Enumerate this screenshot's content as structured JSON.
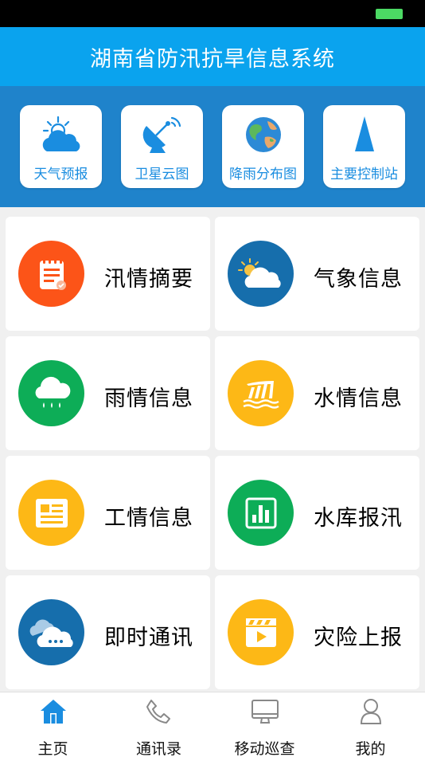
{
  "app": {
    "title": "湖南省防汛抗旱信息系统"
  },
  "colors": {
    "header": "#0aa3ee",
    "band": "#1f83cb",
    "accent": "#1a8de0",
    "battery": "#4cd964"
  },
  "quick_links": [
    {
      "label": "天气预报",
      "icon": "weather-cloud-sun-icon"
    },
    {
      "label": "卫星云图",
      "icon": "satellite-dish-icon"
    },
    {
      "label": "降雨分布图",
      "icon": "globe-icon"
    },
    {
      "label": "主要控制站",
      "icon": "triangle-marker-icon"
    }
  ],
  "modules": [
    {
      "label": "汛情摘要",
      "icon": "notepad-icon",
      "color": "#fc5418"
    },
    {
      "label": "气象信息",
      "icon": "cloud-sun-icon",
      "color": "#166eac"
    },
    {
      "label": "雨情信息",
      "icon": "rain-cloud-icon",
      "color": "#0dad57"
    },
    {
      "label": "水情信息",
      "icon": "water-chart-icon",
      "color": "#fdb816"
    },
    {
      "label": "工情信息",
      "icon": "document-icon",
      "color": "#fdb816"
    },
    {
      "label": "水库报汛",
      "icon": "bar-chart-icon",
      "color": "#0dad57"
    },
    {
      "label": "即时通讯",
      "icon": "chat-cloud-icon",
      "color": "#166eac"
    },
    {
      "label": "灾险上报",
      "icon": "video-clapper-icon",
      "color": "#fdb816"
    }
  ],
  "tabs": [
    {
      "label": "主页",
      "icon": "home-icon",
      "active": true
    },
    {
      "label": "通讯录",
      "icon": "phone-icon",
      "active": false
    },
    {
      "label": "移动巡查",
      "icon": "monitor-icon",
      "active": false
    },
    {
      "label": "我的",
      "icon": "user-icon",
      "active": false
    }
  ]
}
